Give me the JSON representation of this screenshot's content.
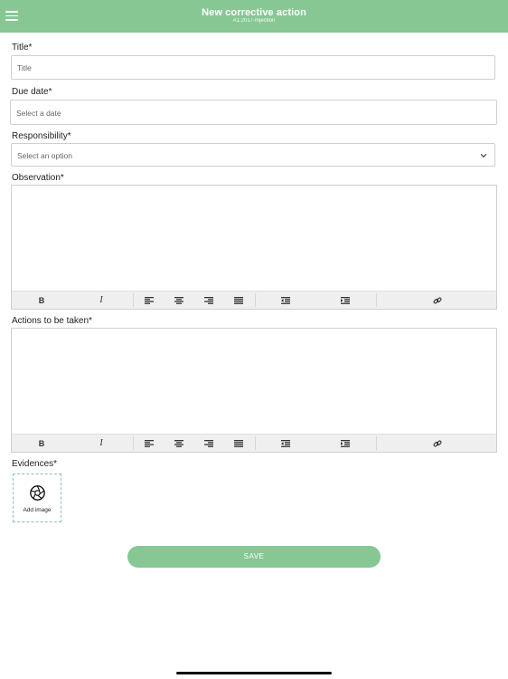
{
  "header": {
    "title": "New corrective action",
    "subtitle": "A1:2017-Injection"
  },
  "form": {
    "title_label": "Title*",
    "title_placeholder": "Title",
    "due_date_label": "Due date*",
    "due_date_placeholder": "Select a date",
    "responsibility_label": "Responsibility*",
    "responsibility_value": "Select an option",
    "observation_label": "Observation*",
    "actions_label": "Actions to be taken*",
    "evidences_label": "Evidences*",
    "add_image_label": "Add image",
    "save_label": "SAVE"
  },
  "toolbar": {
    "bold": "B",
    "italic": "I",
    "icons": [
      "bold-icon",
      "italic-icon",
      "align-left-icon",
      "align-center-icon",
      "align-right-icon",
      "align-justify-icon",
      "outdent-icon",
      "indent-icon",
      "link-icon"
    ]
  },
  "colors": {
    "accent": "#86c794",
    "toolbar_bg": "#efefef",
    "border": "#cfcfcf",
    "evidence_border": "#8bbfb6"
  }
}
